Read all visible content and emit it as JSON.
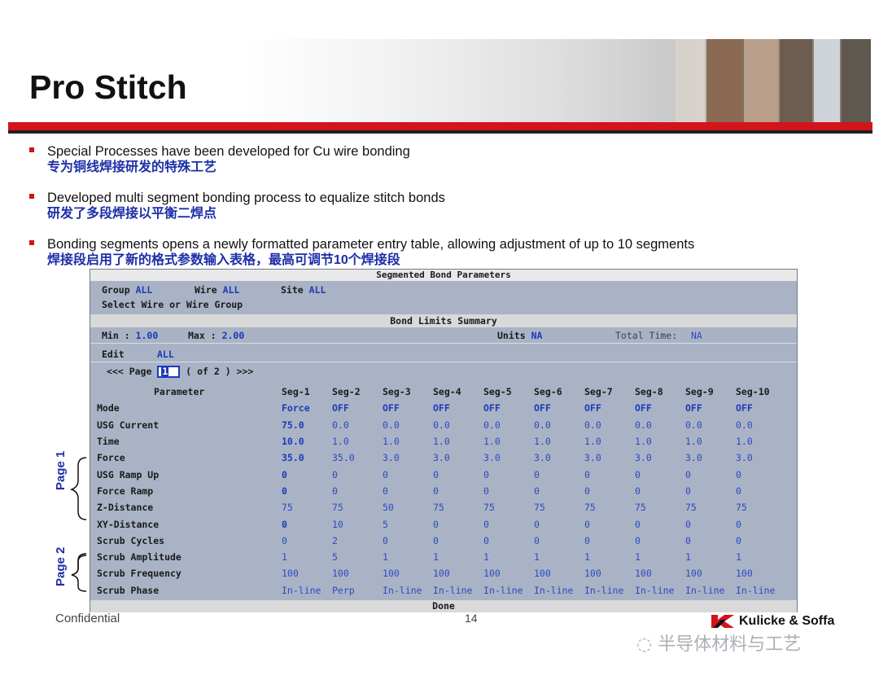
{
  "slide": {
    "title": "Pro Stitch",
    "bullets": [
      {
        "en": "Special Processes have been developed for Cu wire bonding",
        "zh": "专为铜线焊接研发的特殊工艺"
      },
      {
        "en": "Developed multi segment bonding process to equalize stitch bonds",
        "zh": "研发了多段焊接以平衡二焊点"
      },
      {
        "en": "Bonding segments opens a newly formatted parameter entry table, allowing adjustment of up to 10 segments",
        "zh": "焊接段启用了新的格式参数输入表格，最高可调节10个焊接段"
      }
    ],
    "page1_label": "Page 1",
    "page2_label": "Page 2"
  },
  "window": {
    "title": "Segmented Bond Parameters",
    "group_label": "Group",
    "group_value": "ALL",
    "wire_label": "Wire",
    "wire_value": "ALL",
    "site_label": "Site",
    "site_value": "ALL",
    "select_label": "Select Wire or Wire Group",
    "limits_title": "Bond Limits Summary",
    "min_label": "Min :",
    "min_value": "1.00",
    "max_label": "Max :",
    "max_value": "2.00",
    "units_label": "Units",
    "units_value": "NA",
    "total_time_label": "Total Time:",
    "total_time_value": "NA",
    "edit_label": "Edit",
    "edit_value": "ALL",
    "page_prev": "<<< Page",
    "page_current": "1",
    "page_of": "( of 2 )",
    "page_next": ">>>",
    "done_label": "Done",
    "table": {
      "param_header": "Parameter",
      "columns": [
        "Seg-1",
        "Seg-2",
        "Seg-3",
        "Seg-4",
        "Seg-5",
        "Seg-6",
        "Seg-7",
        "Seg-8",
        "Seg-9",
        "Seg-10"
      ],
      "rows": [
        {
          "name": "Mode",
          "values": [
            "Force",
            "OFF",
            "OFF",
            "OFF",
            "OFF",
            "OFF",
            "OFF",
            "OFF",
            "OFF",
            "OFF"
          ]
        },
        {
          "name": "USG Current",
          "values": [
            "75.0",
            "0.0",
            "0.0",
            "0.0",
            "0.0",
            "0.0",
            "0.0",
            "0.0",
            "0.0",
            "0.0"
          ]
        },
        {
          "name": "Time",
          "values": [
            "10.0",
            "1.0",
            "1.0",
            "1.0",
            "1.0",
            "1.0",
            "1.0",
            "1.0",
            "1.0",
            "1.0"
          ]
        },
        {
          "name": "Force",
          "values": [
            "35.0",
            "35.0",
            "3.0",
            "3.0",
            "3.0",
            "3.0",
            "3.0",
            "3.0",
            "3.0",
            "3.0"
          ]
        },
        {
          "name": "USG Ramp Up",
          "values": [
            "0",
            "0",
            "0",
            "0",
            "0",
            "0",
            "0",
            "0",
            "0",
            "0"
          ]
        },
        {
          "name": "Force Ramp",
          "values": [
            "0",
            "0",
            "0",
            "0",
            "0",
            "0",
            "0",
            "0",
            "0",
            "0"
          ]
        },
        {
          "name": "Z-Distance",
          "values": [
            "75",
            "75",
            "50",
            "75",
            "75",
            "75",
            "75",
            "75",
            "75",
            "75"
          ]
        },
        {
          "name": "XY-Distance",
          "values": [
            "0",
            "10",
            "5",
            "0",
            "0",
            "0",
            "0",
            "0",
            "0",
            "0"
          ]
        },
        {
          "name": "Scrub Cycles",
          "values": [
            "0",
            "2",
            "0",
            "0",
            "0",
            "0",
            "0",
            "0",
            "0",
            "0"
          ]
        },
        {
          "name": "Scrub Amplitude",
          "values": [
            "1",
            "5",
            "1",
            "1",
            "1",
            "1",
            "1",
            "1",
            "1",
            "1"
          ]
        },
        {
          "name": "Scrub Frequency",
          "values": [
            "100",
            "100",
            "100",
            "100",
            "100",
            "100",
            "100",
            "100",
            "100",
            "100"
          ]
        },
        {
          "name": "Scrub Phase",
          "values": [
            "In-line",
            "Perp",
            "In-line",
            "In-line",
            "In-line",
            "In-line",
            "In-line",
            "In-line",
            "In-line",
            "In-line"
          ]
        }
      ]
    }
  },
  "footer": {
    "confidential": "Confidential",
    "page_number": "14",
    "brand": "Kulicke & Soffa",
    "watermark": "半导体材料与工艺"
  },
  "colors": {
    "accent_red": "#d3141c",
    "text_blue": "#1d2fa8",
    "window_bg": "#a9b3c5"
  }
}
